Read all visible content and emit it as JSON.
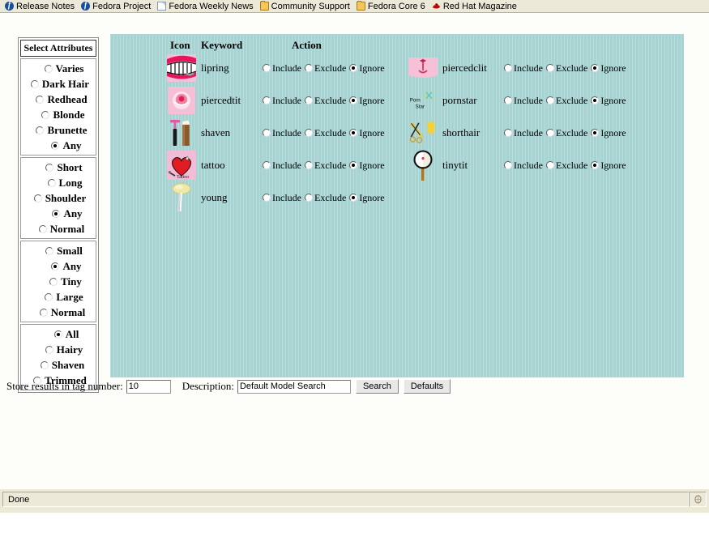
{
  "bookmarks": [
    {
      "label": "Release Notes",
      "icon": "fedora-icon"
    },
    {
      "label": "Fedora Project",
      "icon": "fedora-icon"
    },
    {
      "label": "Fedora Weekly News",
      "icon": "document-icon"
    },
    {
      "label": "Community Support",
      "icon": "folder-icon"
    },
    {
      "label": "Fedora Core 6",
      "icon": "folder-icon"
    },
    {
      "label": "Red Hat Magazine",
      "icon": "redhat-icon"
    }
  ],
  "attributes": {
    "title": "Select Attributes",
    "groups": [
      {
        "name": "hair-color",
        "options": [
          {
            "label": "Varies",
            "selected": false,
            "indent": 14
          },
          {
            "label": "Dark Hair",
            "selected": false,
            "indent": 4
          },
          {
            "label": "Redhead",
            "selected": false,
            "indent": 8
          },
          {
            "label": "Blonde",
            "selected": false,
            "indent": 12
          },
          {
            "label": "Brunette",
            "selected": false,
            "indent": 8
          },
          {
            "label": "Any",
            "selected": true,
            "indent": 20
          }
        ]
      },
      {
        "name": "hair-length",
        "options": [
          {
            "label": "Short",
            "selected": false,
            "indent": 14
          },
          {
            "label": "Long",
            "selected": false,
            "indent": 16
          },
          {
            "label": "Shoulder",
            "selected": false,
            "indent": 4
          },
          {
            "label": "Any",
            "selected": true,
            "indent": 22
          },
          {
            "label": "Normal",
            "selected": false,
            "indent": 8
          }
        ]
      },
      {
        "name": "size",
        "options": [
          {
            "label": "Small",
            "selected": false,
            "indent": 14
          },
          {
            "label": "Any",
            "selected": true,
            "indent": 20
          },
          {
            "label": "Tiny",
            "selected": false,
            "indent": 18
          },
          {
            "label": "Large",
            "selected": false,
            "indent": 14
          },
          {
            "label": "Normal",
            "selected": false,
            "indent": 10
          }
        ]
      },
      {
        "name": "grooming",
        "options": [
          {
            "label": "All",
            "selected": true,
            "indent": 20
          },
          {
            "label": "Hairy",
            "selected": false,
            "indent": 14
          },
          {
            "label": "Shaven",
            "selected": false,
            "indent": 10
          },
          {
            "label": "Trimmed",
            "selected": false,
            "indent": 4
          }
        ]
      }
    ]
  },
  "keyword_table": {
    "headers": {
      "icon": "Icon",
      "keyword": "Keyword",
      "action": "Action"
    },
    "action_options": [
      "Include",
      "Exclude",
      "Ignore"
    ],
    "rows": [
      [
        {
          "keyword": "lipring",
          "icon": "lips-teeth-icon",
          "selected": "Ignore"
        },
        {
          "keyword": "piercedclit",
          "icon": "piercing-icon",
          "selected": "Ignore"
        }
      ],
      [
        {
          "keyword": "piercedtit",
          "icon": "pierced-nipple-icon",
          "selected": "Ignore"
        },
        {
          "keyword": "pornstar",
          "icon": "porn-star-icon",
          "selected": "Ignore",
          "icon_text": "Porn Star"
        }
      ],
      [
        {
          "keyword": "shaven",
          "icon": "razor-icon",
          "selected": "Ignore"
        },
        {
          "keyword": "shorthair",
          "icon": "scissors-icon",
          "selected": "Ignore"
        }
      ],
      [
        {
          "keyword": "tattoo",
          "icon": "heart-tattoo-icon",
          "selected": "Ignore"
        },
        {
          "keyword": "tinytit",
          "icon": "magnifier-icon",
          "selected": "Ignore"
        }
      ],
      [
        {
          "keyword": "young",
          "icon": "lollipop-icon",
          "selected": "Ignore"
        }
      ]
    ]
  },
  "form": {
    "tag_label": "Store results in tag number:",
    "tag_value": "10",
    "desc_label": "Description:",
    "desc_value": "Default Model Search",
    "search_button": "Search",
    "defaults_button": "Defaults"
  },
  "status": {
    "text": "Done"
  },
  "colors": {
    "panel_bg": "#a7d3d2",
    "page_bg": "#fdfdfa",
    "chrome_bg": "#ece9d8",
    "icon_pink": "#f5c0d8"
  }
}
